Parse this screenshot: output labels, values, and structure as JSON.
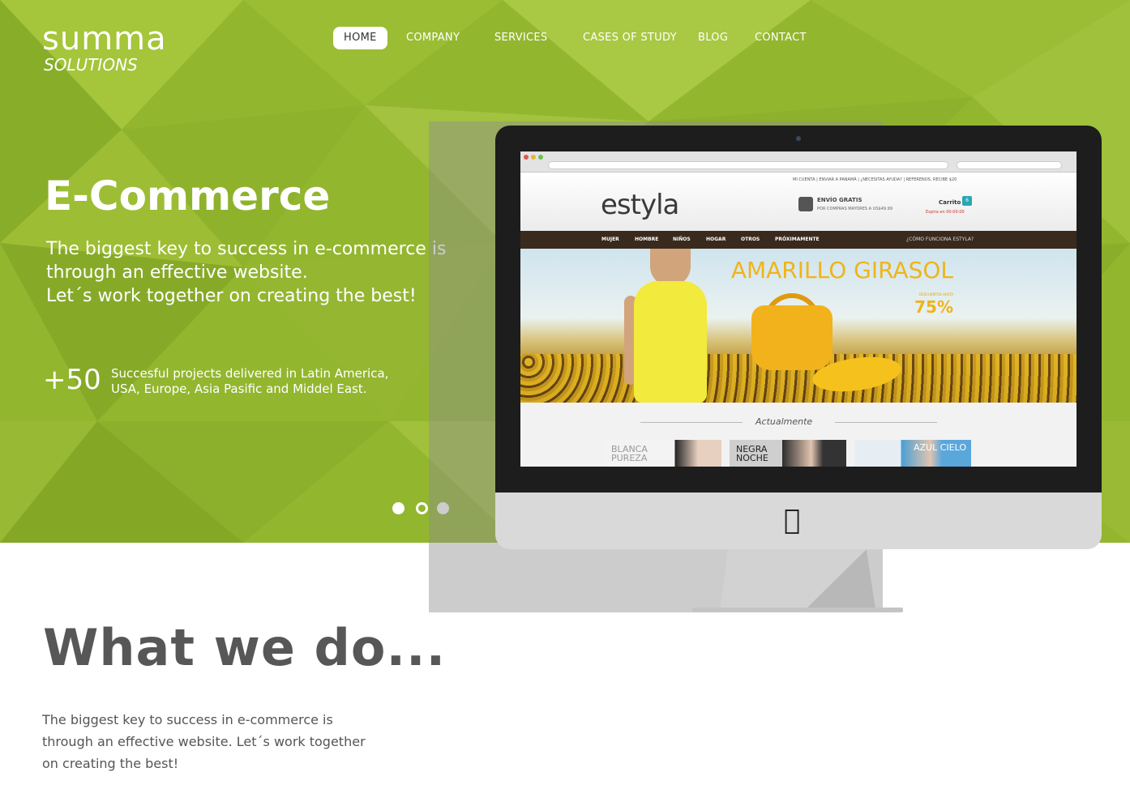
{
  "logo": {
    "word": "summa",
    "sub": "SOLUTIONS"
  },
  "nav": {
    "items": [
      {
        "label": "HOME",
        "active": true
      },
      {
        "label": "COMPANY",
        "active": false
      },
      {
        "label": "SERVICES",
        "active": false
      },
      {
        "label": "CASES OF STUDY",
        "active": false
      },
      {
        "label": "BLOG",
        "active": false
      },
      {
        "label": "CONTACT",
        "active": false
      }
    ]
  },
  "hero": {
    "title": "E-Commerce",
    "text": [
      "The biggest key to success in e-commerce is",
      "through an effective website.",
      "Let´s work together on creating the best!"
    ],
    "stat_number": "+50",
    "stat_text": [
      "Succesful projects delivered in Latin America,",
      "USA, Europe, Asia Pasific and Middel East."
    ],
    "slide_dots": [
      {
        "name": "slide-dot-1",
        "state": "filled"
      },
      {
        "name": "slide-dot-2",
        "state": "outline"
      },
      {
        "name": "slide-dot-3",
        "state": "filled"
      }
    ]
  },
  "mockup": {
    "site_logo": "estyla",
    "top_links": "MI CUENTA  |  ENVIAR A  PANAMÁ  |  ¿NECESITAS AYUDA?  |  REFERENOS, RECIBE $20",
    "shipping_title": "ENVÍO GRATIS",
    "shipping_sub": "POR COMPRAS MAYORES A US$49.99",
    "cart_label": "Carrito",
    "cart_count": "6",
    "expires": "Expira en  00:00:00",
    "nav": [
      "MUJER",
      "HOMBRE",
      "NIÑOS",
      "HOGAR",
      "OTROS",
      "PRÓXIMAMENTE"
    ],
    "help_link": "¿CÓMO FUNCIONA ESTYLA?",
    "promo_title": "AMARILLO GIRASOL",
    "promo_small": "DESCUENTOS HASTA",
    "promo_pct": "75%",
    "section_label": "Actualmente",
    "thumbs": [
      {
        "label": "BLANCA\nPUREZA"
      },
      {
        "label": "NEGRA\nNOCHE"
      },
      {
        "label": "AZUL CIELO"
      }
    ]
  },
  "section": {
    "title": "What we do...",
    "desc": [
      "The biggest key to success in e-commerce is",
      "through an effective website. Let´s work together",
      "on creating the best!"
    ]
  },
  "colors": {
    "hero_green": "#93b62f",
    "text_gray": "#575757",
    "promo_yellow": "#f0b419",
    "site_nav_brown": "#3a2a1e"
  }
}
